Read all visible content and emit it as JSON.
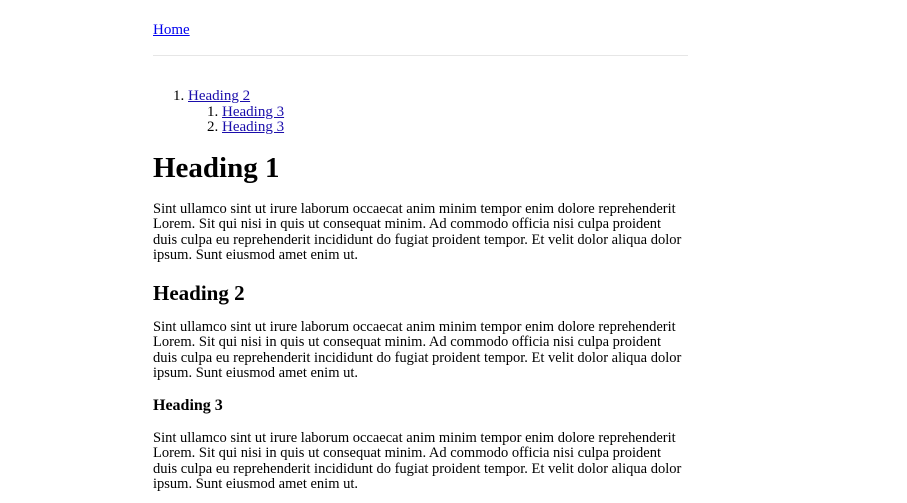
{
  "nav": {
    "home_label": "Home"
  },
  "toc": {
    "items": [
      {
        "number": "1.",
        "label": "Heading 2"
      },
      {
        "number": "1.",
        "label": "Heading 3"
      },
      {
        "number": "2.",
        "label": "Heading 3"
      }
    ]
  },
  "content": {
    "heading1": "Heading 1",
    "paragraph1": "Sint ullamco sint ut irure laborum occaecat anim minim tempor enim dolore reprehenderit Lorem. Sit qui nisi in quis ut consequat minim. Ad commodo officia nisi culpa proident duis culpa eu reprehenderit incididunt do fugiat proident tempor. Et velit dolor aliqua dolor ipsum. Sunt eiusmod amet enim ut.",
    "heading2": "Heading 2",
    "paragraph2": "Sint ullamco sint ut irure laborum occaecat anim minim tempor enim dolore reprehenderit Lorem. Sit qui nisi in quis ut consequat minim. Ad commodo officia nisi culpa proident duis culpa eu reprehenderit incididunt do fugiat proident tempor. Et velit dolor aliqua dolor ipsum. Sunt eiusmod amet enim ut.",
    "heading3": "Heading 3",
    "paragraph3": "Sint ullamco sint ut irure laborum occaecat anim minim tempor enim dolore reprehenderit Lorem. Sit qui nisi in quis ut consequat minim. Ad commodo officia nisi culpa proident duis culpa eu reprehenderit incididunt do fugiat proident tempor. Et velit dolor aliqua dolor ipsum. Sunt eiusmod amet enim ut."
  },
  "colors": {
    "link": "#1a0dab",
    "visited_link": "#551a8b",
    "divider": "#e6e6e6",
    "text": "#000000"
  }
}
